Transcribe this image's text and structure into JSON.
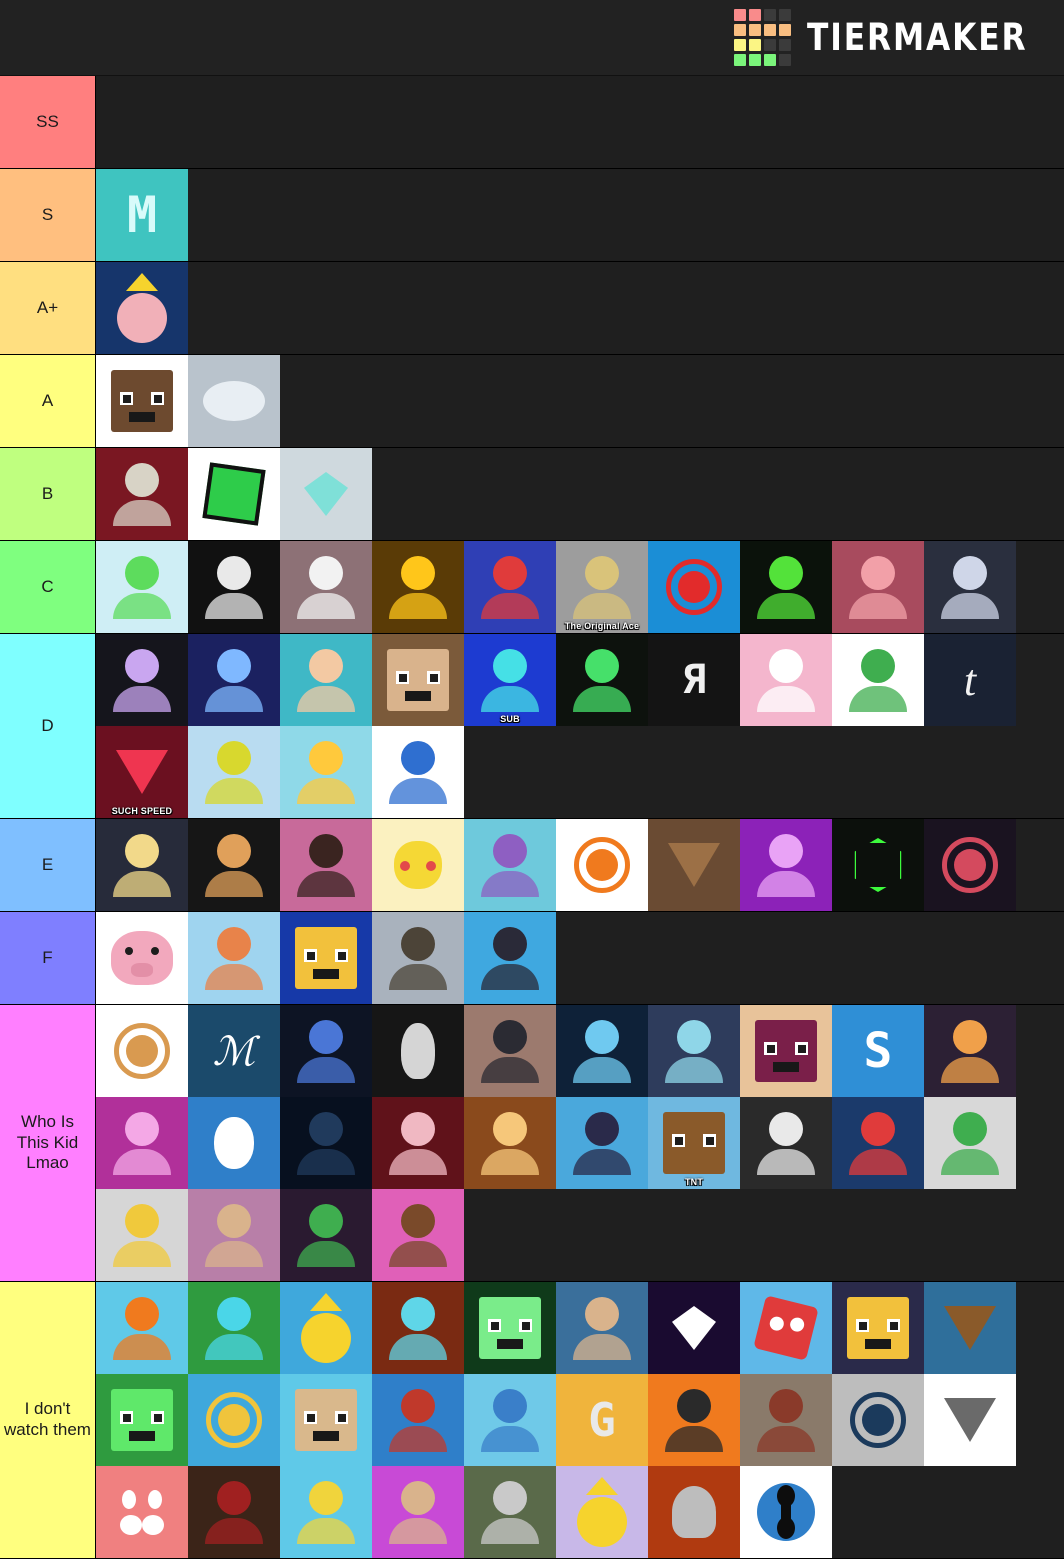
{
  "header": {
    "logo_text": "TIERMAKER",
    "logo_icon": "tiermaker-grid-icon",
    "logo_grid_colors": [
      "#f98b8b",
      "#f98b8b",
      "#3b3b3b",
      "#3b3b3b",
      "#f9be81",
      "#f9be81",
      "#f9be81",
      "#f9be81",
      "#fbf584",
      "#fbf584",
      "#3b3b3b",
      "#3b3b3b",
      "#7bf57b",
      "#7bf57b",
      "#7bf57b",
      "#3b3b3b"
    ]
  },
  "tiers": [
    {
      "label": "SS",
      "color": "#ff7f7f",
      "items": []
    },
    {
      "label": "S",
      "color": "#ffbf7f",
      "items": [
        {
          "name": "mumbo-jumbo-avatar",
          "bg": "#3fc4c0",
          "art": "pixel-m-logo",
          "fg": "#d8fbfa",
          "caption": ""
        }
      ]
    },
    {
      "label": "A+",
      "color": "#ffdf80",
      "items": [
        {
          "name": "technoblade-avatar",
          "bg": "#16356b",
          "art": "crowned-pig",
          "fg": "#f1b0b8",
          "caption": ""
        }
      ]
    },
    {
      "label": "A",
      "color": "#ffff7f",
      "items": [
        {
          "name": "grian-avatar",
          "bg": "#ffffff",
          "art": "minecraft-head",
          "fg": "#6d4a2f",
          "caption": ""
        },
        {
          "name": "baby-seal-avatar",
          "bg": "#b9c3cc",
          "art": "seal",
          "fg": "#e8eef3",
          "caption": ""
        }
      ]
    },
    {
      "label": "B",
      "color": "#bfff7f",
      "items": [
        {
          "name": "crossbow-skin-avatar",
          "bg": "#7a1722",
          "art": "crossbow",
          "fg": "#d8d3c6",
          "caption": ""
        },
        {
          "name": "pixelcube-logo-avatar",
          "bg": "#ffffff",
          "art": "cube-face",
          "fg": "#2ecc4a",
          "caption": ""
        },
        {
          "name": "diamond-armor-avatar",
          "bg": "#cfd9de",
          "art": "diamond-armor-skin",
          "fg": "#7fe0d8",
          "caption": ""
        }
      ]
    },
    {
      "label": "C",
      "color": "#7fff7f",
      "items": [
        {
          "name": "green-turtle-avatar",
          "bg": "#cfeef5",
          "art": "turtle",
          "fg": "#5ddc5d",
          "caption": ""
        },
        {
          "name": "anime-face-avatar",
          "bg": "#111111",
          "art": "anime-face",
          "fg": "#e9e9e9",
          "caption": ""
        },
        {
          "name": "white-glow-avatar",
          "bg": "#8d7176",
          "art": "bright-scene",
          "fg": "#f2f2f2",
          "caption": ""
        },
        {
          "name": "fire-suit-avatar",
          "bg": "#5a3b06",
          "art": "suit-character",
          "fg": "#ffc61a",
          "caption": ""
        },
        {
          "name": "santa-hat-avatar",
          "bg": "#2f3fb5",
          "art": "santa-character",
          "fg": "#e03b3b",
          "caption": ""
        },
        {
          "name": "the-original-ace-avatar",
          "bg": "#9d9d9d",
          "art": "face-photo",
          "fg": "#d9c37a",
          "caption": "The Original Ace"
        },
        {
          "name": "red-dog-logo-avatar",
          "bg": "#1b8ed6",
          "art": "dog-logo",
          "fg": "#e22b2b",
          "caption": ""
        },
        {
          "name": "green-hood-avatar",
          "bg": "#0b120b",
          "art": "hooded-figure",
          "fg": "#53e23a",
          "caption": ""
        },
        {
          "name": "fire-render-avatar",
          "bg": "#a84b5e",
          "art": "fire-scene",
          "fg": "#f2a0a8",
          "caption": ""
        },
        {
          "name": "bow-render-avatar",
          "bg": "#2a2f3e",
          "art": "bow-scene",
          "fg": "#cfd6e8",
          "caption": ""
        }
      ]
    },
    {
      "label": "D",
      "color": "#7fffff",
      "items": [
        {
          "name": "lightning-skin-avatar",
          "bg": "#15151c",
          "art": "lightning-scene",
          "fg": "#c9a6f0",
          "caption": ""
        },
        {
          "name": "blue-sword-render-avatar",
          "bg": "#1b2160",
          "art": "blue-render",
          "fg": "#7fb8ff",
          "caption": ""
        },
        {
          "name": "brown-hair-boy-avatar",
          "bg": "#3fb8c6",
          "art": "cartoon-boy",
          "fg": "#f3c9a3",
          "caption": ""
        },
        {
          "name": "blocky-face-avatar",
          "bg": "#7b5a3a",
          "art": "blocky-face",
          "fg": "#d9b38c",
          "caption": ""
        },
        {
          "name": "sub-robot-avatar",
          "bg": "#1d3bd1",
          "art": "cyan-robot",
          "fg": "#45e0e6",
          "caption": "SUB"
        },
        {
          "name": "green-glow-avatar",
          "bg": "#0d120d",
          "art": "green-glow",
          "fg": "#46e06a",
          "caption": ""
        },
        {
          "name": "white-logo-avatar",
          "bg": "#141414",
          "art": "letter-logo",
          "fg": "#f0f0f0",
          "caption": ""
        },
        {
          "name": "christmas-bunny-avatar",
          "bg": "#f4b6cd",
          "art": "bunny-character",
          "fg": "#ffffff",
          "caption": ""
        },
        {
          "name": "green-mask-avatar",
          "bg": "#ffffff",
          "art": "masked-character",
          "fg": "#3fae4f",
          "caption": ""
        },
        {
          "name": "cursive-t-avatar",
          "bg": "#1a2233",
          "art": "cursive-t",
          "fg": "#f2f2f2",
          "caption": ""
        },
        {
          "name": "such-speed-avatar",
          "bg": "#6b1020",
          "art": "wolf-logo",
          "fg": "#ef3550",
          "caption": "SUCH SPEED"
        },
        {
          "name": "yellow-cube-avatar",
          "bg": "#b9dcf1",
          "art": "yellow-cube-head",
          "fg": "#d8d82e",
          "caption": ""
        },
        {
          "name": "fire-girl-avatar",
          "bg": "#8fd9e8",
          "art": "fire-girl",
          "fg": "#ffc93c",
          "caption": ""
        },
        {
          "name": "blue-mask-hero-avatar",
          "bg": "#ffffff",
          "art": "masked-hero",
          "fg": "#2f6fd0",
          "caption": ""
        }
      ]
    },
    {
      "label": "E",
      "color": "#7fbfff",
      "items": [
        {
          "name": "blonde-anime-avatar",
          "bg": "#272b3a",
          "art": "blonde-anime",
          "fg": "#f2d98a",
          "caption": ""
        },
        {
          "name": "suit-cartoon-avatar",
          "bg": "#161616",
          "art": "suit-cartoon",
          "fg": "#e0a05a",
          "caption": ""
        },
        {
          "name": "curly-hair-boy-avatar",
          "bg": "#c86a9a",
          "art": "curly-boy",
          "fg": "#3a2420",
          "caption": ""
        },
        {
          "name": "pikachu-suit-avatar",
          "bg": "#fbf1c0",
          "art": "pikachu-suit",
          "fg": "#f5d835",
          "caption": ""
        },
        {
          "name": "purple-block-avatar",
          "bg": "#6ec9dc",
          "art": "purple-block-guy",
          "fg": "#8e5fc2",
          "caption": ""
        },
        {
          "name": "gun-cartoon-avatar",
          "bg": "#ffffff",
          "art": "gun-cartoon",
          "fg": "#f07a1e",
          "caption": ""
        },
        {
          "name": "furry-face-avatar",
          "bg": "#6a4b33",
          "art": "furry-face",
          "fg": "#9c7046",
          "caption": ""
        },
        {
          "name": "purple-glow-avatar",
          "bg": "#8c22b8",
          "art": "purple-glow-char",
          "fg": "#e9a3f6",
          "caption": ""
        },
        {
          "name": "green-b-logo-avatar",
          "bg": "#0c100c",
          "art": "octagon-b",
          "fg": "#3dfb3d",
          "caption": ""
        },
        {
          "name": "panda-logo-avatar",
          "bg": "#1a1320",
          "art": "panda-logo",
          "fg": "#d44a5e",
          "caption": ""
        }
      ]
    },
    {
      "label": "F",
      "color": "#7f7fff",
      "items": [
        {
          "name": "pink-pig-avatar",
          "bg": "#ffffff",
          "art": "pig-face",
          "fg": "#f2a8bd",
          "caption": ""
        },
        {
          "name": "ginger-hoodie-avatar",
          "bg": "#9fd4ef",
          "art": "ginger-character",
          "fg": "#e8834a",
          "caption": ""
        },
        {
          "name": "gold-armor-avatar",
          "bg": "#1639a8",
          "art": "gold-armor-skin",
          "fg": "#f2c13c",
          "caption": ""
        },
        {
          "name": "grin-anime-avatar",
          "bg": "#a9b2bd",
          "art": "grinning-anime",
          "fg": "#4c4438",
          "caption": ""
        },
        {
          "name": "hooded-grin-avatar",
          "bg": "#3fa8e0",
          "art": "hooded-grin",
          "fg": "#2a2a38",
          "caption": ""
        }
      ]
    },
    {
      "label": "Who Is This Kid Lmao",
      "color": "#ff7fff",
      "items": [
        {
          "name": "hamster-avatar",
          "bg": "#ffffff",
          "art": "hamster",
          "fg": "#d99a50",
          "caption": ""
        },
        {
          "name": "calligraphy-logo-avatar",
          "bg": "#1b4a6b",
          "art": "calligraphy",
          "fg": "#ffffff",
          "caption": ""
        },
        {
          "name": "blue-hoodie-chibi-avatar",
          "bg": "#0d1424",
          "art": "chibi-hoodie",
          "fg": "#4a76d6",
          "caption": ""
        },
        {
          "name": "astronaut-logo-avatar",
          "bg": "#161616",
          "art": "astronaut",
          "fg": "#d5d5d5",
          "caption": ""
        },
        {
          "name": "enderman-build-avatar",
          "bg": "#9c7a6e",
          "art": "build-scene",
          "fg": "#2b2b33",
          "caption": ""
        },
        {
          "name": "blue-render-avatar",
          "bg": "#0e2138",
          "art": "blue-render-2",
          "fg": "#6fc9f0",
          "caption": ""
        },
        {
          "name": "sword-render-avatar",
          "bg": "#2e3c5c",
          "art": "sword-render",
          "fg": "#8fd6e8",
          "caption": ""
        },
        {
          "name": "skin-face-avatar",
          "bg": "#e8c39a",
          "art": "skin-face",
          "fg": "#7a1f49",
          "caption": ""
        },
        {
          "name": "s-logo-avatar",
          "bg": "#2f8fd6",
          "art": "letter-s",
          "fg": "#ffffff",
          "caption": ""
        },
        {
          "name": "fire-bow-avatar",
          "bg": "#2c2034",
          "art": "fire-bow",
          "fg": "#f0a04a",
          "caption": ""
        },
        {
          "name": "pink-render-avatar",
          "bg": "#b1309a",
          "art": "pink-render",
          "fg": "#f4a8e6",
          "caption": ""
        },
        {
          "name": "penguin-bow-avatar",
          "bg": "#2f7fc9",
          "art": "penguin-archer",
          "fg": "#ffffff",
          "caption": ""
        },
        {
          "name": "dark-blue-avatar",
          "bg": "#07101f",
          "art": "dark-scene",
          "fg": "#203a5c",
          "caption": ""
        },
        {
          "name": "santa-villain-avatar",
          "bg": "#60121a",
          "art": "santa-villain",
          "fg": "#f0b8c2",
          "caption": ""
        },
        {
          "name": "golden-boy-avatar",
          "bg": "#8a4a1c",
          "art": "golden-boy",
          "fg": "#f6c77a",
          "caption": ""
        },
        {
          "name": "blue-hair-boy-avatar",
          "bg": "#4aa8dc",
          "art": "blue-hair-boy",
          "fg": "#2a2a4a",
          "caption": ""
        },
        {
          "name": "tnt-owl-avatar",
          "bg": "#6fb8e0",
          "art": "owl-character",
          "fg": "#8a5a2a",
          "caption": "TNT"
        },
        {
          "name": "white-sketch-avatar",
          "bg": "#2a2a2a",
          "art": "sketch-scene",
          "fg": "#e9e9e9",
          "caption": ""
        },
        {
          "name": "red-shirt-boy-avatar",
          "bg": "#1b3a6b",
          "art": "red-shirt-boy",
          "fg": "#e03b3b",
          "caption": ""
        },
        {
          "name": "green-hood-char-avatar",
          "bg": "#d8d8d8",
          "art": "green-hood-char",
          "fg": "#3fae4f",
          "caption": ""
        },
        {
          "name": "blonde-laugh-avatar",
          "bg": "#d6d6d6",
          "art": "laughing-blonde",
          "fg": "#f0c93c",
          "caption": ""
        },
        {
          "name": "sunglasses-guy-avatar",
          "bg": "#b87fa8",
          "art": "sunglasses-guy",
          "fg": "#d9b38c",
          "caption": ""
        },
        {
          "name": "green-jacket-avatar",
          "bg": "#2a1a30",
          "art": "green-jacket",
          "fg": "#3fae4f",
          "caption": ""
        },
        {
          "name": "red-eyes-anime-avatar",
          "bg": "#e060b8",
          "art": "red-eyes-anime",
          "fg": "#7a4a2a",
          "caption": ""
        }
      ]
    },
    {
      "label": "I don't watch them",
      "color": "#ffff7f",
      "items": [
        {
          "name": "orange-mask-avatar",
          "bg": "#5fc9e8",
          "art": "orange-mask",
          "fg": "#f07a1e",
          "caption": ""
        },
        {
          "name": "green-sword-boy-avatar",
          "bg": "#2f9b3f",
          "art": "green-sword-boy",
          "fg": "#4ad6e8",
          "caption": ""
        },
        {
          "name": "crown-block-avatar",
          "bg": "#3fa8dc",
          "art": "crown-block-head",
          "fg": "#f6d32d",
          "caption": ""
        },
        {
          "name": "dark-sword-avatar",
          "bg": "#7a2a12",
          "art": "dark-sword-render",
          "fg": "#5fd6e8",
          "caption": ""
        },
        {
          "name": "green-slime-avatar",
          "bg": "#0f3a1a",
          "art": "green-slime",
          "fg": "#7aec8a",
          "caption": ""
        },
        {
          "name": "beard-sunglasses-avatar",
          "bg": "#3a6f9b",
          "art": "bearded-guy",
          "fg": "#d9b38c",
          "caption": ""
        },
        {
          "name": "diamond-logo-avatar",
          "bg": "#1a0b30",
          "art": "diamond-logo",
          "fg": "#ffffff",
          "caption": ""
        },
        {
          "name": "red-card-face-avatar",
          "bg": "#5fb8e8",
          "art": "red-card-face",
          "fg": "#e03b3b",
          "caption": ""
        },
        {
          "name": "gold-armor-smile-avatar",
          "bg": "#2a2a4a",
          "art": "gold-armor-smile",
          "fg": "#f2c13c",
          "caption": ""
        },
        {
          "name": "werewolf-avatar",
          "bg": "#2f6f9b",
          "art": "werewolf",
          "fg": "#8a5a2a",
          "caption": ""
        },
        {
          "name": "green-creeper-face-avatar",
          "bg": "#2f9b3f",
          "art": "creeper-face",
          "fg": "#5fe86a",
          "caption": ""
        },
        {
          "name": "s-circle-logo-avatar",
          "bg": "#3fa8dc",
          "art": "s-circle",
          "fg": "#f0c43c",
          "caption": ""
        },
        {
          "name": "tan-block-face-avatar",
          "bg": "#5fc9e8",
          "art": "tan-block-face",
          "fg": "#d9b88c",
          "caption": ""
        },
        {
          "name": "plaid-hood-avatar",
          "bg": "#2f7fc9",
          "art": "plaid-hood",
          "fg": "#c0392b",
          "caption": ""
        },
        {
          "name": "blue-hoodie-sword-avatar",
          "bg": "#6fc9e8",
          "art": "blue-hoodie-sword",
          "fg": "#3a7fc9",
          "caption": ""
        },
        {
          "name": "g-lightning-logo-avatar",
          "bg": "#f0b43c",
          "art": "g-lightning",
          "fg": "#e9e9e9",
          "caption": ""
        },
        {
          "name": "glasses-orange-avatar",
          "bg": "#f07a1e",
          "art": "glasses-orange",
          "fg": "#2a2a2a",
          "caption": ""
        },
        {
          "name": "beard-skin-avatar",
          "bg": "#8a7a6a",
          "art": "beard-skin",
          "fg": "#8a3a2a",
          "caption": ""
        },
        {
          "name": "circle-logo-avatar",
          "bg": "#bdbdbd",
          "art": "circle-logo",
          "fg": "#1b3a5c",
          "caption": ""
        },
        {
          "name": "wolf-head-avatar",
          "bg": "#ffffff",
          "art": "wolf-head",
          "fg": "#6a6a6a",
          "caption": ""
        },
        {
          "name": "mustache-face-avatar",
          "bg": "#f08080",
          "art": "mustache-face",
          "fg": "#ffffff",
          "caption": ""
        },
        {
          "name": "red-frame-boy-avatar",
          "bg": "#3b2418",
          "art": "red-frame-boy",
          "fg": "#a02020",
          "caption": ""
        },
        {
          "name": "blonde-wave-avatar",
          "bg": "#5fc9e8",
          "art": "blonde-wave",
          "fg": "#f0d43c",
          "caption": ""
        },
        {
          "name": "scarf-boy-avatar",
          "bg": "#c84ad6",
          "art": "scarf-boy",
          "fg": "#d9b38c",
          "caption": ""
        },
        {
          "name": "grass-field-avatar",
          "bg": "#5a6a4a",
          "art": "grass-scene",
          "fg": "#c9c9c9",
          "caption": ""
        },
        {
          "name": "crown-girl-avatar",
          "bg": "#c8b8e8",
          "art": "crown-girl",
          "fg": "#f6d32d",
          "caption": ""
        },
        {
          "name": "fire-helmet-avatar",
          "bg": "#b03a10",
          "art": "fire-helmet",
          "fg": "#bdbdbd",
          "caption": ""
        },
        {
          "name": "blue-x-logo-avatar",
          "bg": "#ffffff",
          "art": "blue-x-logo",
          "fg": "#2f7fc9",
          "caption": ""
        }
      ]
    }
  ]
}
